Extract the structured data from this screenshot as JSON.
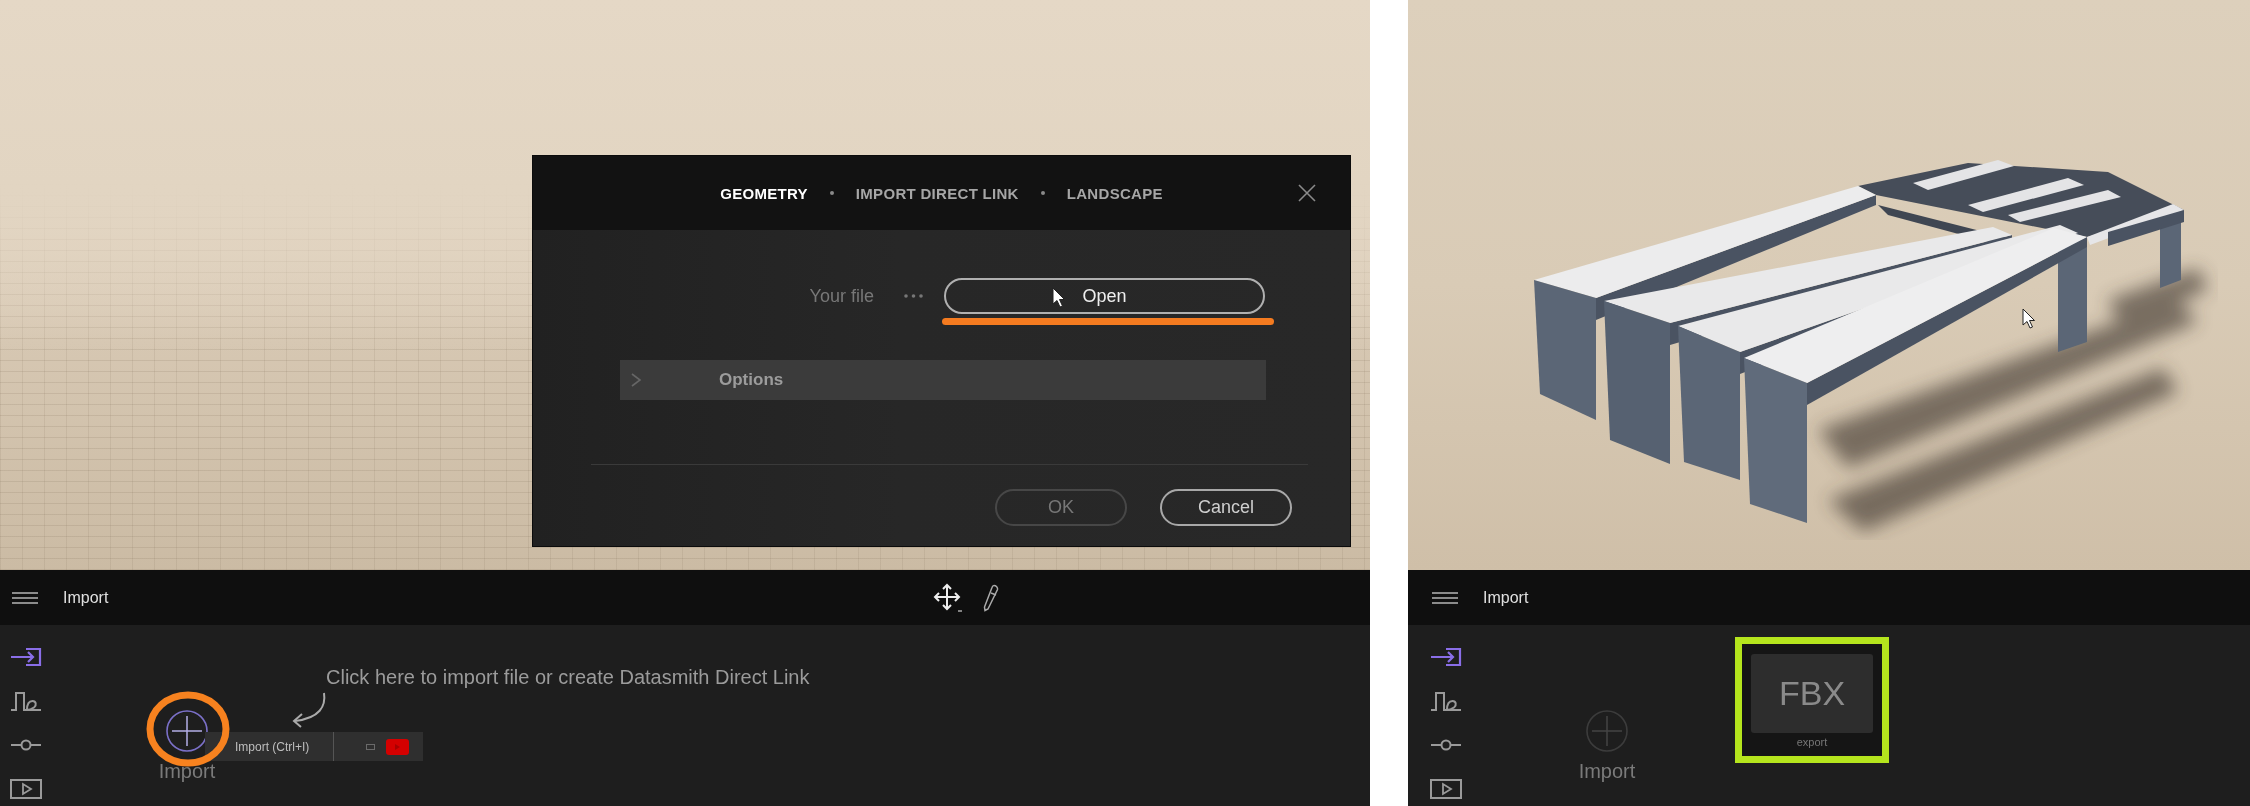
{
  "left_screen": {
    "viewport": {
      "kind": "floor"
    },
    "dialog": {
      "tabs": [
        {
          "label": "GEOMETRY",
          "selected": true
        },
        {
          "label": "IMPORT DIRECT LINK",
          "selected": false
        },
        {
          "label": "LANDSCAPE",
          "selected": false
        }
      ],
      "file_label": "Your file",
      "open_button": {
        "label": "Open",
        "highlighted": true
      },
      "options": {
        "label": "Options",
        "expanded": false
      },
      "buttons": [
        {
          "label": "OK",
          "disabled": true
        },
        {
          "label": "Cancel",
          "disabled": false
        }
      ]
    },
    "panel": {
      "title": "Import",
      "toolbar": [
        {
          "kind": "move"
        },
        {
          "kind": "eyedropper"
        }
      ],
      "sidebar": [
        {
          "kind": "import",
          "selected": true
        },
        {
          "kind": "wave",
          "selected": false
        },
        {
          "kind": "slider",
          "selected": false
        },
        {
          "kind": "video",
          "selected": false
        }
      ],
      "hint": "Click here to import file or create Datasmith Direct Link",
      "import_button": {
        "label": "Import",
        "hovered": true,
        "highlighted": true
      },
      "tooltip": {
        "label": "Import (Ctrl+I)"
      }
    }
  },
  "right_screen": {
    "viewport": {
      "kind": "model"
    },
    "panel": {
      "title": "Import",
      "sidebar": [
        {
          "kind": "import",
          "selected": true
        },
        {
          "kind": "wave",
          "selected": false
        },
        {
          "kind": "slider",
          "selected": false
        },
        {
          "kind": "video",
          "selected": false
        }
      ],
      "import_button": {
        "label": "Import",
        "hovered": false
      },
      "files": [
        {
          "label": "FBX",
          "caption": "export",
          "highlighted": true
        }
      ]
    }
  }
}
